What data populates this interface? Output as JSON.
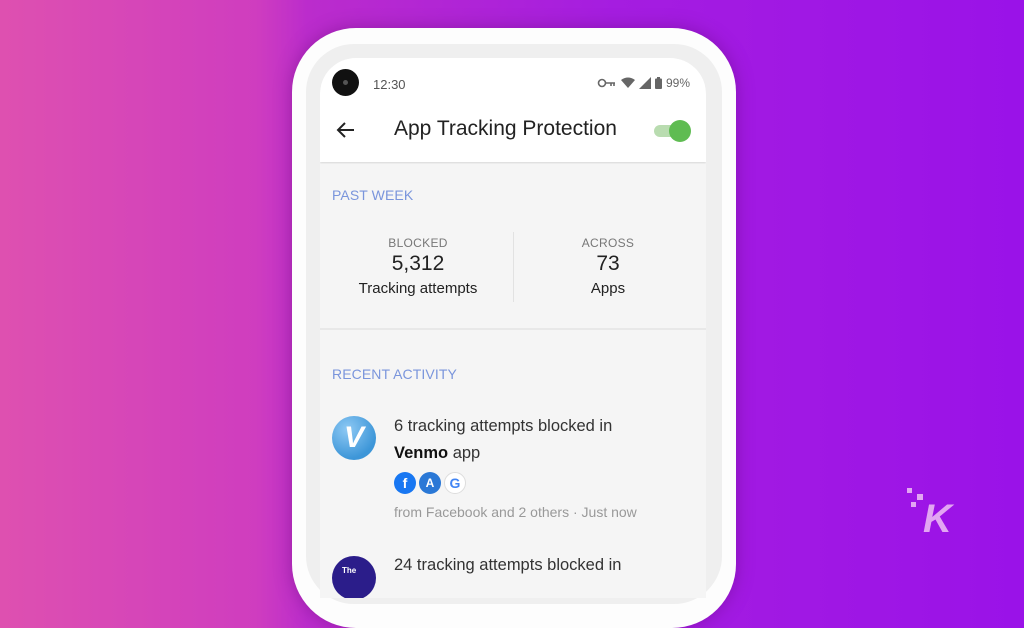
{
  "background": {
    "gradient_start": "#de50b0",
    "gradient_end": "#9a12e8"
  },
  "status_bar": {
    "time": "12:30",
    "icons": [
      "vpn-key-icon",
      "wifi-icon",
      "cell-signal-icon",
      "battery-icon"
    ],
    "battery": "99%"
  },
  "header": {
    "back_icon": "arrow-left-icon",
    "title": "App Tracking Protection",
    "toggle_on": true,
    "toggle_color": "#5fbc52"
  },
  "past_week": {
    "label": "PAST WEEK",
    "blocked": {
      "caption": "BLOCKED",
      "value": "5,312",
      "sub": "Tracking attempts"
    },
    "across": {
      "caption": "ACROSS",
      "value": "73",
      "sub": "Apps"
    }
  },
  "recent_activity": {
    "label": "RECENT ACTIVITY",
    "items": [
      {
        "app_icon": "venmo-icon",
        "app_icon_letter": "V",
        "text_prefix": "6 tracking attempts blocked in",
        "app_name": "Venmo",
        "text_suffix": " app",
        "trackers": [
          {
            "name": "facebook-icon",
            "glyph": "f"
          },
          {
            "name": "adjust-icon",
            "glyph": "A"
          },
          {
            "name": "google-icon",
            "glyph": "G"
          }
        ],
        "meta": "from Facebook and 2 others · Just now"
      },
      {
        "app_icon": "the-app-icon",
        "app_icon_letter": "The",
        "text_prefix": "24 tracking attempts blocked in"
      }
    ]
  },
  "watermark": {
    "letter": "K"
  }
}
